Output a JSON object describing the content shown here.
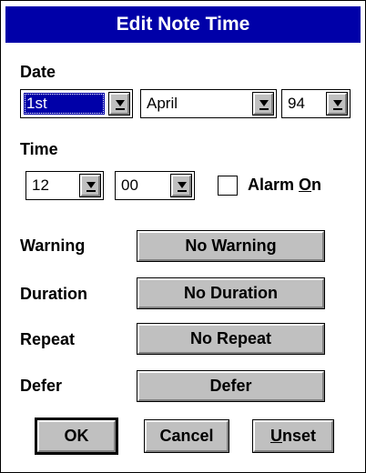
{
  "dialog": {
    "title": "Edit Note Time",
    "date_label": "Date",
    "day": "1st",
    "month": "April",
    "year": "94",
    "time_label": "Time",
    "hour": "12",
    "minute": "00",
    "alarm": {
      "prefix": "Alarm ",
      "mnemonic": "O",
      "suffix": "n",
      "checked": false
    },
    "rows": [
      {
        "label": "Warning",
        "button": "No Warning"
      },
      {
        "label": "Duration",
        "button": "No Duration"
      },
      {
        "label": "Repeat",
        "button": "No Repeat"
      },
      {
        "label": "Defer",
        "button": "Defer"
      }
    ],
    "ok_label": "OK",
    "cancel_label": "Cancel",
    "unset": {
      "mnemonic": "U",
      "suffix": "nset"
    }
  },
  "colors": {
    "titlebar": "#0000a8",
    "face": "#c0c0c0",
    "selection": "#0000a8"
  },
  "icons": {
    "dropdown": "down-arrow-bar-icon"
  }
}
